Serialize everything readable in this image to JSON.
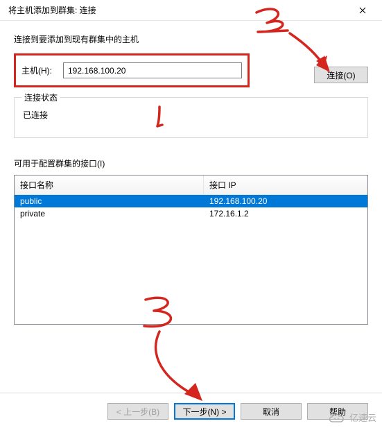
{
  "window": {
    "title": "将主机添加到群集:  连接"
  },
  "instruction": "连接到要添加到现有群集中的主机",
  "host": {
    "label": "主机(H):",
    "value": "192.168.100.20",
    "connect_label": "连接(O)"
  },
  "status_group": {
    "legend": "连接状态",
    "status": "已连接"
  },
  "interfaces": {
    "label": "可用于配置群集的接口(I)",
    "columns": {
      "name": "接口名称",
      "ip": "接口 IP"
    },
    "rows": [
      {
        "name": "public",
        "ip": "192.168.100.20",
        "selected": true
      },
      {
        "name": "private",
        "ip": "172.16.1.2",
        "selected": false
      }
    ]
  },
  "footer": {
    "back": "< 上一步(B)",
    "next": "下一步(N)  >",
    "cancel": "取消",
    "help": "帮助"
  },
  "annotations": {
    "step2": "2",
    "step3": "3"
  },
  "watermark": "亿速云"
}
